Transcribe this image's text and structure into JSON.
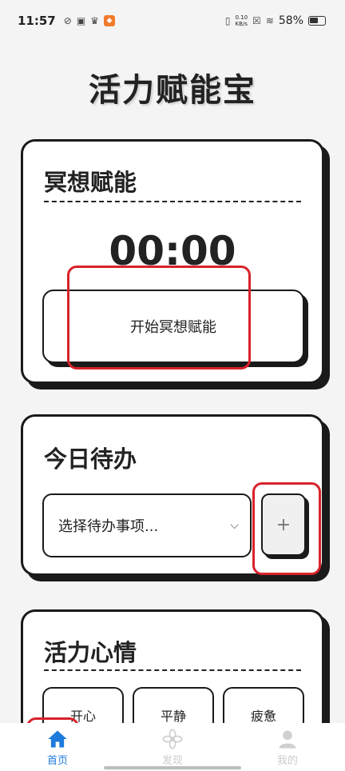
{
  "status_bar": {
    "time": "11:57",
    "net_speed_value": "0.10",
    "net_speed_unit": "KB/s",
    "battery": "58%"
  },
  "app": {
    "title": "活力赋能宝"
  },
  "meditation": {
    "title": "冥想赋能",
    "timer": "00:00",
    "start_label": "开始冥想赋能"
  },
  "todo": {
    "title": "今日待办",
    "select_placeholder": "选择待办事项...",
    "add_label": "+"
  },
  "mood": {
    "title": "活力心情",
    "options": [
      "开心",
      "平静",
      "疲惫"
    ]
  },
  "nav": {
    "items": [
      {
        "label": "首页",
        "icon": "home-icon",
        "active": true
      },
      {
        "label": "发现",
        "icon": "discover-icon",
        "active": false
      },
      {
        "label": "我的",
        "icon": "profile-icon",
        "active": false
      }
    ]
  },
  "colors": {
    "accent": "#1e7bdc",
    "highlight": "#d8222b",
    "border": "#1a1a1a"
  }
}
